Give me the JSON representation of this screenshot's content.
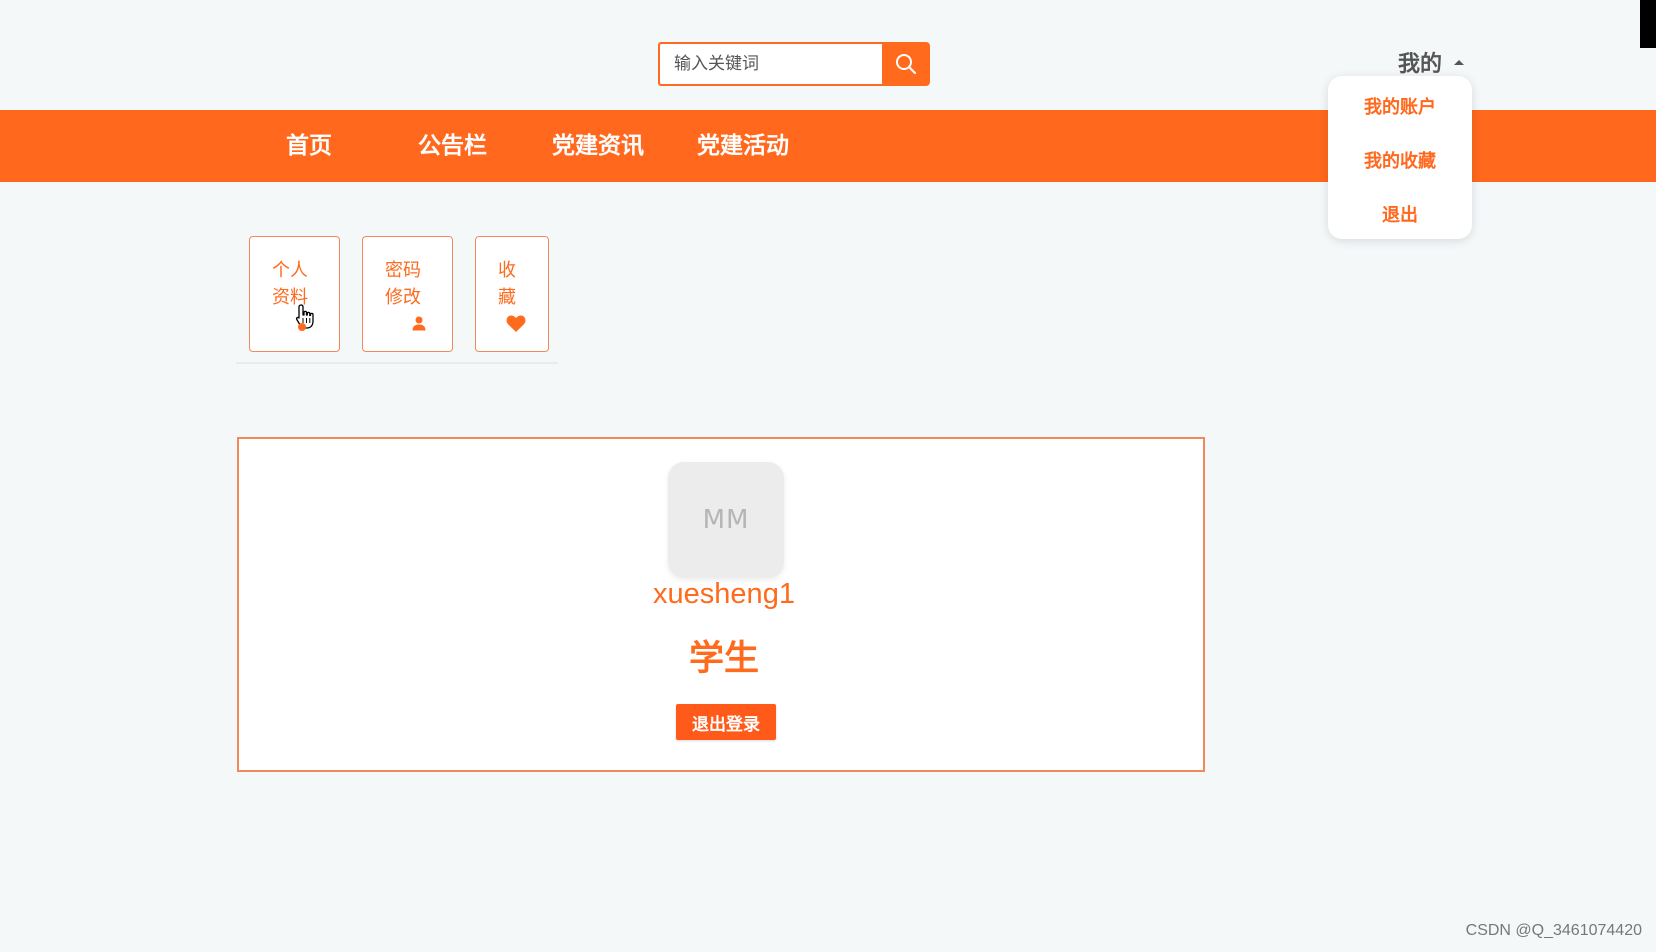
{
  "search": {
    "placeholder": "输入关键词",
    "button_icon": "search-icon"
  },
  "account_menu": {
    "toggle_label": "我的",
    "items": [
      "我的账户",
      "我的收藏",
      "退出"
    ]
  },
  "nav": {
    "items": [
      "首页",
      "公告栏",
      "党建资讯",
      "党建活动"
    ]
  },
  "side_tabs": [
    {
      "label": "个人资料",
      "icon": "pointer-cursor-icon"
    },
    {
      "label": "密码修改",
      "icon": "user-icon"
    },
    {
      "label": "收藏",
      "icon": "heart-icon"
    }
  ],
  "profile": {
    "avatar_text": "MM",
    "username": "xuesheng1",
    "role": "学生",
    "logout_label": "退出登录"
  },
  "colors": {
    "accent": "#ff681d",
    "background": "#f4f8f9"
  },
  "watermark": "CSDN @Q_3461074420"
}
